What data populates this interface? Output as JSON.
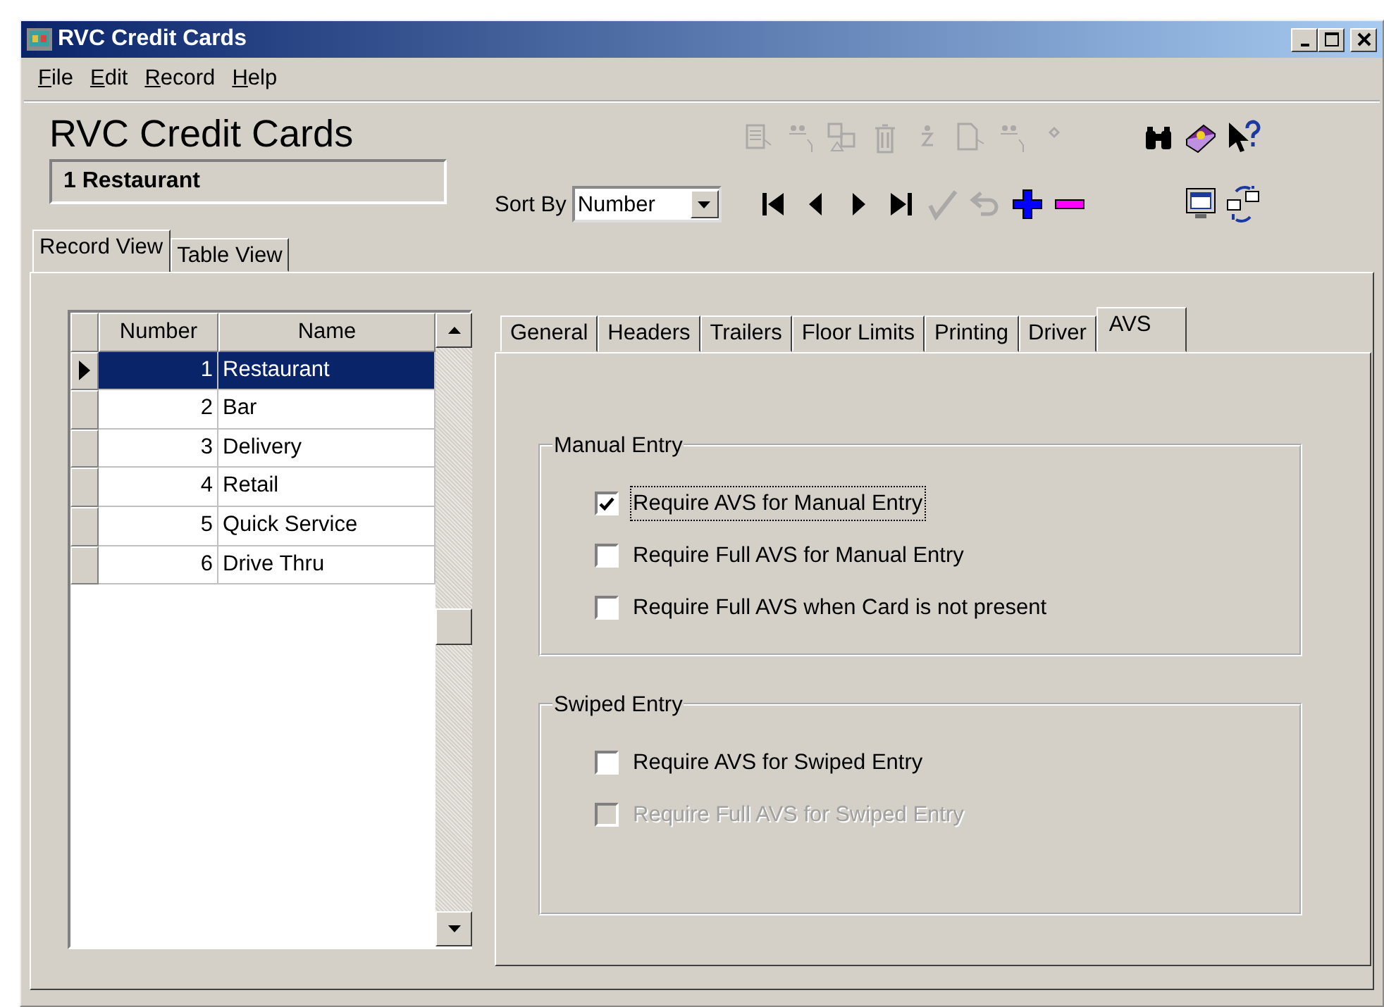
{
  "window": {
    "title": "RVC Credit Cards"
  },
  "menu": [
    {
      "label": "File"
    },
    {
      "label": "Edit"
    },
    {
      "label": "Record"
    },
    {
      "label": "Help"
    }
  ],
  "header": {
    "title": "RVC Credit Cards",
    "record": "1 Restaurant",
    "sort_label": "Sort By",
    "sort_value": "Number"
  },
  "toolbar_top": [
    {
      "kind": "grid-edit",
      "disabled": true
    },
    {
      "kind": "people",
      "disabled": true
    },
    {
      "kind": "copy",
      "disabled": true
    },
    {
      "kind": "trash",
      "disabled": true
    },
    {
      "kind": "person-two",
      "disabled": true
    },
    {
      "kind": "page-edit",
      "disabled": true
    },
    {
      "kind": "people",
      "disabled": true
    },
    {
      "kind": "dot",
      "disabled": true
    }
  ],
  "toolbar_top_right": [
    {
      "kind": "binoculars",
      "disabled": false
    },
    {
      "kind": "book",
      "disabled": false
    },
    {
      "kind": "help",
      "disabled": false
    }
  ],
  "toolbar_nav": [
    {
      "kind": "first",
      "disabled": false
    },
    {
      "kind": "prev",
      "disabled": false
    },
    {
      "kind": "next",
      "disabled": false
    },
    {
      "kind": "last",
      "disabled": false
    },
    {
      "kind": "check",
      "disabled": true
    },
    {
      "kind": "undo",
      "disabled": true
    },
    {
      "kind": "plus",
      "disabled": false
    },
    {
      "kind": "minus",
      "disabled": false
    }
  ],
  "toolbar_nav_right": [
    {
      "kind": "monitor",
      "disabled": false
    },
    {
      "kind": "swap",
      "disabled": false
    }
  ],
  "view_tabs": [
    {
      "label": "Record View",
      "selected": true
    },
    {
      "label": "Table View",
      "selected": false
    }
  ],
  "grid": {
    "columns": [
      "Number",
      "Name"
    ],
    "rows": [
      {
        "number": "1",
        "name": "Restaurant",
        "selected": true
      },
      {
        "number": "2",
        "name": "Bar",
        "selected": false
      },
      {
        "number": "3",
        "name": "Delivery",
        "selected": false
      },
      {
        "number": "4",
        "name": "Retail",
        "selected": false
      },
      {
        "number": "5",
        "name": "Quick Service",
        "selected": false
      },
      {
        "number": "6",
        "name": "Drive Thru",
        "selected": false
      }
    ]
  },
  "detail_tabs": [
    {
      "label": "General",
      "selected": false
    },
    {
      "label": "Headers",
      "selected": false
    },
    {
      "label": "Trailers",
      "selected": false
    },
    {
      "label": "Floor Limits",
      "selected": false
    },
    {
      "label": "Printing",
      "selected": false
    },
    {
      "label": "Driver",
      "selected": false
    },
    {
      "label": "AVS",
      "selected": true
    }
  ],
  "groups": [
    {
      "title": "Manual Entry",
      "options": [
        {
          "label": "Require AVS for Manual Entry",
          "checked": true,
          "disabled": false,
          "focused": true
        },
        {
          "label": "Require Full AVS for Manual Entry",
          "checked": false,
          "disabled": false,
          "focused": false
        },
        {
          "label": "Require Full AVS when Card is not present",
          "checked": false,
          "disabled": false,
          "focused": false
        }
      ]
    },
    {
      "title": "Swiped Entry",
      "options": [
        {
          "label": "Require AVS for Swiped Entry",
          "checked": false,
          "disabled": false,
          "focused": false
        },
        {
          "label": "Require Full AVS for Swiped Entry",
          "checked": false,
          "disabled": true,
          "focused": false
        }
      ]
    }
  ]
}
